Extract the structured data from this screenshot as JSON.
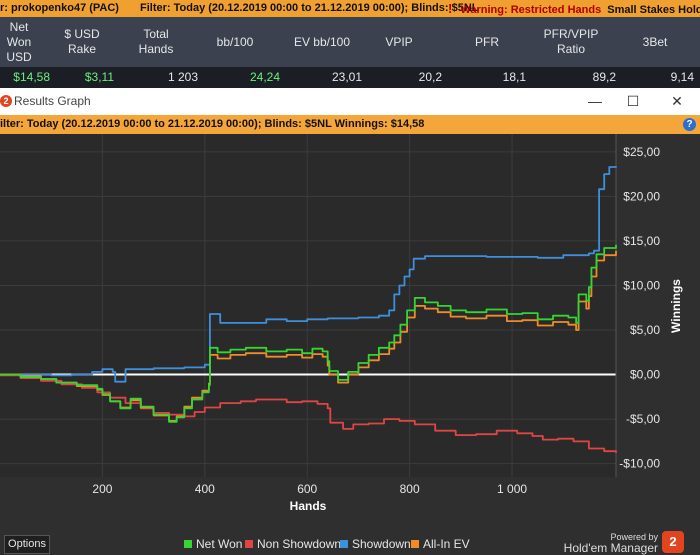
{
  "topbar": {
    "player": "r: prokopenko47 (PAC)",
    "filter": "Filter: Today (20.12.2019 00:00 to 21.12.2019 00:00); Blinds: $5NL",
    "warning_icon": "!",
    "warning_label": "Warning: Restricted Hands",
    "warning_extra": "Small Stakes Holdem"
  },
  "stats": {
    "headers": [
      "Net\nWon\nUSD",
      "$ USD\nRake",
      "Total\nHands",
      "bb/100",
      "EV bb/100",
      "VPIP",
      "PFR",
      "PFR/VPIP\nRatio",
      "3Bet"
    ],
    "values": [
      "$14,58",
      "$3,11",
      "1 203",
      "24,24",
      "23,01",
      "20,2",
      "18,1",
      "89,2",
      "9,14"
    ]
  },
  "window": {
    "title": "Results Graph",
    "logo": "2",
    "minimize_glyph": "—",
    "maximize_glyph": "☐",
    "close_glyph": "✕"
  },
  "filterbar": {
    "text": "ilter: Today (20.12.2019 00:00 to 21.12.2019 00:00); Blinds: $5NL Winnings: $14,58",
    "help_glyph": "?"
  },
  "chart_data": {
    "type": "line",
    "xlabel": "Hands",
    "ylabel": "Winnings",
    "xlim": [
      0,
      1203
    ],
    "ylim": [
      -11.5,
      27
    ],
    "x_ticks": [
      200,
      400,
      600,
      800,
      1000
    ],
    "x_tick_labels": [
      "200",
      "400",
      "600",
      "800",
      "1 000"
    ],
    "y_ticks": [
      25,
      20,
      15,
      10,
      5,
      0,
      -5,
      -10
    ],
    "y_tick_labels": [
      "$25,00",
      "$20,00",
      "$15,00",
      "$10,00",
      "$5,00",
      "$0,00",
      "-$5,00",
      "-$10,00"
    ],
    "grid": true,
    "legend_position": "bottom",
    "series": [
      {
        "name": "Net Won",
        "color": "#33d633",
        "points": [
          [
            0,
            0
          ],
          [
            40,
            -0.3
          ],
          [
            80,
            -0.5
          ],
          [
            110,
            -0.9
          ],
          [
            150,
            -1.2
          ],
          [
            190,
            -1.6
          ],
          [
            200,
            -2.2
          ],
          [
            215,
            -3.0
          ],
          [
            235,
            -3.8
          ],
          [
            255,
            -2.7
          ],
          [
            275,
            -3.6
          ],
          [
            300,
            -4.5
          ],
          [
            330,
            -5.3
          ],
          [
            345,
            -4.8
          ],
          [
            360,
            -3.8
          ],
          [
            375,
            -2.8
          ],
          [
            395,
            -2.0
          ],
          [
            408,
            -1.2
          ],
          [
            410,
            3.0
          ],
          [
            425,
            2.5
          ],
          [
            450,
            2.8
          ],
          [
            480,
            3.0
          ],
          [
            520,
            2.6
          ],
          [
            560,
            2.8
          ],
          [
            590,
            2.4
          ],
          [
            610,
            2.9
          ],
          [
            630,
            2.6
          ],
          [
            640,
            1.5
          ],
          [
            643,
            0.4
          ],
          [
            660,
            -0.6
          ],
          [
            680,
            0.3
          ],
          [
            700,
            1.3
          ],
          [
            720,
            2.2
          ],
          [
            740,
            3.0
          ],
          [
            760,
            3.6
          ],
          [
            770,
            4.4
          ],
          [
            782,
            5.6
          ],
          [
            795,
            7.2
          ],
          [
            810,
            8.6
          ],
          [
            830,
            8.1
          ],
          [
            855,
            7.7
          ],
          [
            880,
            7.2
          ],
          [
            910,
            7.0
          ],
          [
            950,
            7.3
          ],
          [
            990,
            6.8
          ],
          [
            1020,
            6.9
          ],
          [
            1050,
            6.2
          ],
          [
            1080,
            6.6
          ],
          [
            1110,
            6.4
          ],
          [
            1125,
            5.8
          ],
          [
            1130,
            9.0
          ],
          [
            1145,
            8.3
          ],
          [
            1150,
            9.8
          ],
          [
            1155,
            12.0
          ],
          [
            1165,
            13.5
          ],
          [
            1180,
            14.2
          ],
          [
            1203,
            14.58
          ]
        ]
      },
      {
        "name": "Non Showdown",
        "color": "#e04545",
        "points": [
          [
            0,
            -0.1
          ],
          [
            40,
            -0.4
          ],
          [
            80,
            -0.7
          ],
          [
            120,
            -1.1
          ],
          [
            160,
            -1.5
          ],
          [
            190,
            -2.0
          ],
          [
            215,
            -2.6
          ],
          [
            245,
            -3.2
          ],
          [
            275,
            -3.8
          ],
          [
            300,
            -4.3
          ],
          [
            330,
            -4.5
          ],
          [
            360,
            -4.7
          ],
          [
            380,
            -4.2
          ],
          [
            400,
            -3.7
          ],
          [
            430,
            -3.2
          ],
          [
            470,
            -3.0
          ],
          [
            500,
            -2.8
          ],
          [
            530,
            -2.8
          ],
          [
            560,
            -3.1
          ],
          [
            590,
            -3.0
          ],
          [
            620,
            -3.3
          ],
          [
            640,
            -3.8
          ],
          [
            645,
            -5.4
          ],
          [
            670,
            -6.1
          ],
          [
            690,
            -5.6
          ],
          [
            720,
            -5.5
          ],
          [
            750,
            -5.0
          ],
          [
            780,
            -5.2
          ],
          [
            810,
            -5.6
          ],
          [
            850,
            -6.3
          ],
          [
            890,
            -6.8
          ],
          [
            930,
            -6.7
          ],
          [
            970,
            -6.3
          ],
          [
            1010,
            -6.6
          ],
          [
            1040,
            -6.9
          ],
          [
            1060,
            -7.3
          ],
          [
            1090,
            -7.2
          ],
          [
            1120,
            -7.5
          ],
          [
            1150,
            -8.3
          ],
          [
            1180,
            -8.6
          ],
          [
            1203,
            -8.8
          ]
        ]
      },
      {
        "name": "Showdown",
        "color": "#3e8fdc",
        "points": [
          [
            0,
            0
          ],
          [
            60,
            0
          ],
          [
            100,
            -0.1
          ],
          [
            140,
            0
          ],
          [
            180,
            0.3
          ],
          [
            200,
            0.6
          ],
          [
            220,
            0.3
          ],
          [
            225,
            -0.8
          ],
          [
            245,
            0.6
          ],
          [
            300,
            0.7
          ],
          [
            360,
            0.8
          ],
          [
            400,
            1.1
          ],
          [
            410,
            6.8
          ],
          [
            430,
            5.8
          ],
          [
            480,
            5.8
          ],
          [
            520,
            6.2
          ],
          [
            560,
            6.0
          ],
          [
            600,
            6.2
          ],
          [
            640,
            6.3
          ],
          [
            700,
            6.4
          ],
          [
            740,
            6.6
          ],
          [
            760,
            7.2
          ],
          [
            770,
            9.0
          ],
          [
            780,
            10.0
          ],
          [
            790,
            11.0
          ],
          [
            800,
            11.8
          ],
          [
            808,
            13.0
          ],
          [
            830,
            13.3
          ],
          [
            880,
            13.3
          ],
          [
            950,
            13.2
          ],
          [
            1010,
            13.2
          ],
          [
            1050,
            13.1
          ],
          [
            1100,
            13.4
          ],
          [
            1130,
            13.4
          ],
          [
            1150,
            13.6
          ],
          [
            1160,
            13.9
          ],
          [
            1170,
            20.8
          ],
          [
            1180,
            22.5
          ],
          [
            1190,
            23.3
          ],
          [
            1203,
            23.4
          ]
        ]
      },
      {
        "name": "All-In EV",
        "color": "#f08c28",
        "points": [
          [
            0,
            0
          ],
          [
            40,
            -0.2
          ],
          [
            80,
            -0.5
          ],
          [
            110,
            -0.9
          ],
          [
            150,
            -1.3
          ],
          [
            190,
            -1.7
          ],
          [
            200,
            -2.3
          ],
          [
            215,
            -3.0
          ],
          [
            235,
            -3.7
          ],
          [
            255,
            -2.9
          ],
          [
            275,
            -3.7
          ],
          [
            300,
            -4.6
          ],
          [
            330,
            -5.2
          ],
          [
            345,
            -4.7
          ],
          [
            360,
            -3.6
          ],
          [
            375,
            -2.6
          ],
          [
            395,
            -1.8
          ],
          [
            408,
            -1.0
          ],
          [
            410,
            2.2
          ],
          [
            425,
            1.8
          ],
          [
            450,
            2.2
          ],
          [
            480,
            2.4
          ],
          [
            520,
            2.0
          ],
          [
            560,
            2.2
          ],
          [
            590,
            1.9
          ],
          [
            610,
            2.3
          ],
          [
            630,
            2.0
          ],
          [
            640,
            1.0
          ],
          [
            643,
            0.0
          ],
          [
            660,
            -0.9
          ],
          [
            680,
            0.0
          ],
          [
            700,
            0.8
          ],
          [
            720,
            1.6
          ],
          [
            740,
            2.3
          ],
          [
            760,
            2.9
          ],
          [
            770,
            3.6
          ],
          [
            782,
            4.8
          ],
          [
            795,
            6.4
          ],
          [
            810,
            7.7
          ],
          [
            830,
            7.4
          ],
          [
            855,
            7.0
          ],
          [
            880,
            6.5
          ],
          [
            910,
            6.3
          ],
          [
            950,
            6.6
          ],
          [
            990,
            6.0
          ],
          [
            1020,
            6.1
          ],
          [
            1050,
            5.5
          ],
          [
            1080,
            5.9
          ],
          [
            1110,
            5.6
          ],
          [
            1125,
            5.0
          ],
          [
            1130,
            8.2
          ],
          [
            1145,
            7.4
          ],
          [
            1150,
            8.8
          ],
          [
            1155,
            11.0
          ],
          [
            1165,
            12.8
          ],
          [
            1180,
            13.4
          ],
          [
            1203,
            13.9
          ]
        ]
      }
    ]
  },
  "legend": [
    "Net Won",
    "Non Showdown",
    "Showdown",
    "All-In EV"
  ],
  "bottombar": {
    "options_label": "Options",
    "powered_by": "Powered by",
    "brand": "Hold'em Manager",
    "badge": "2"
  }
}
